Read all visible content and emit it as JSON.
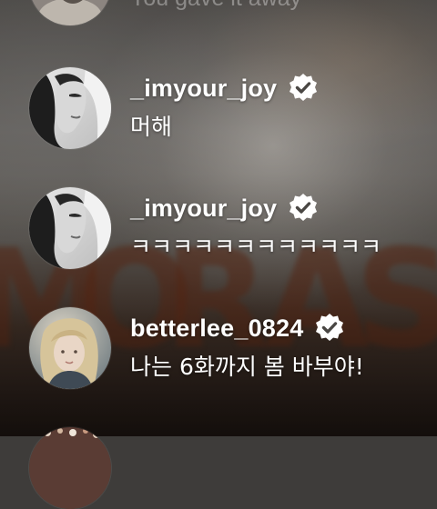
{
  "background": {
    "letters": [
      "M",
      "O",
      "R",
      "A",
      "S"
    ]
  },
  "previous_comment": {
    "message": "You gave it away"
  },
  "comments": [
    {
      "username": "_imyour_joy",
      "verified": true,
      "message": "머해",
      "avatar": "grayscale-portrait"
    },
    {
      "username": "_imyour_joy",
      "verified": true,
      "message": "ㅋㅋㅋㅋㅋㅋㅋㅋㅋㅋㅋㅋ",
      "avatar": "grayscale-portrait"
    },
    {
      "username": "betterlee_0824",
      "verified": true,
      "message": "나는 6화까지 봄 바부야!",
      "avatar": "blonde-portrait"
    }
  ],
  "icons": {
    "verified": "verified-badge-icon"
  },
  "colors": {
    "text": "#ffffff",
    "badge": "#ffffff",
    "badge_check": "#4a4744"
  }
}
